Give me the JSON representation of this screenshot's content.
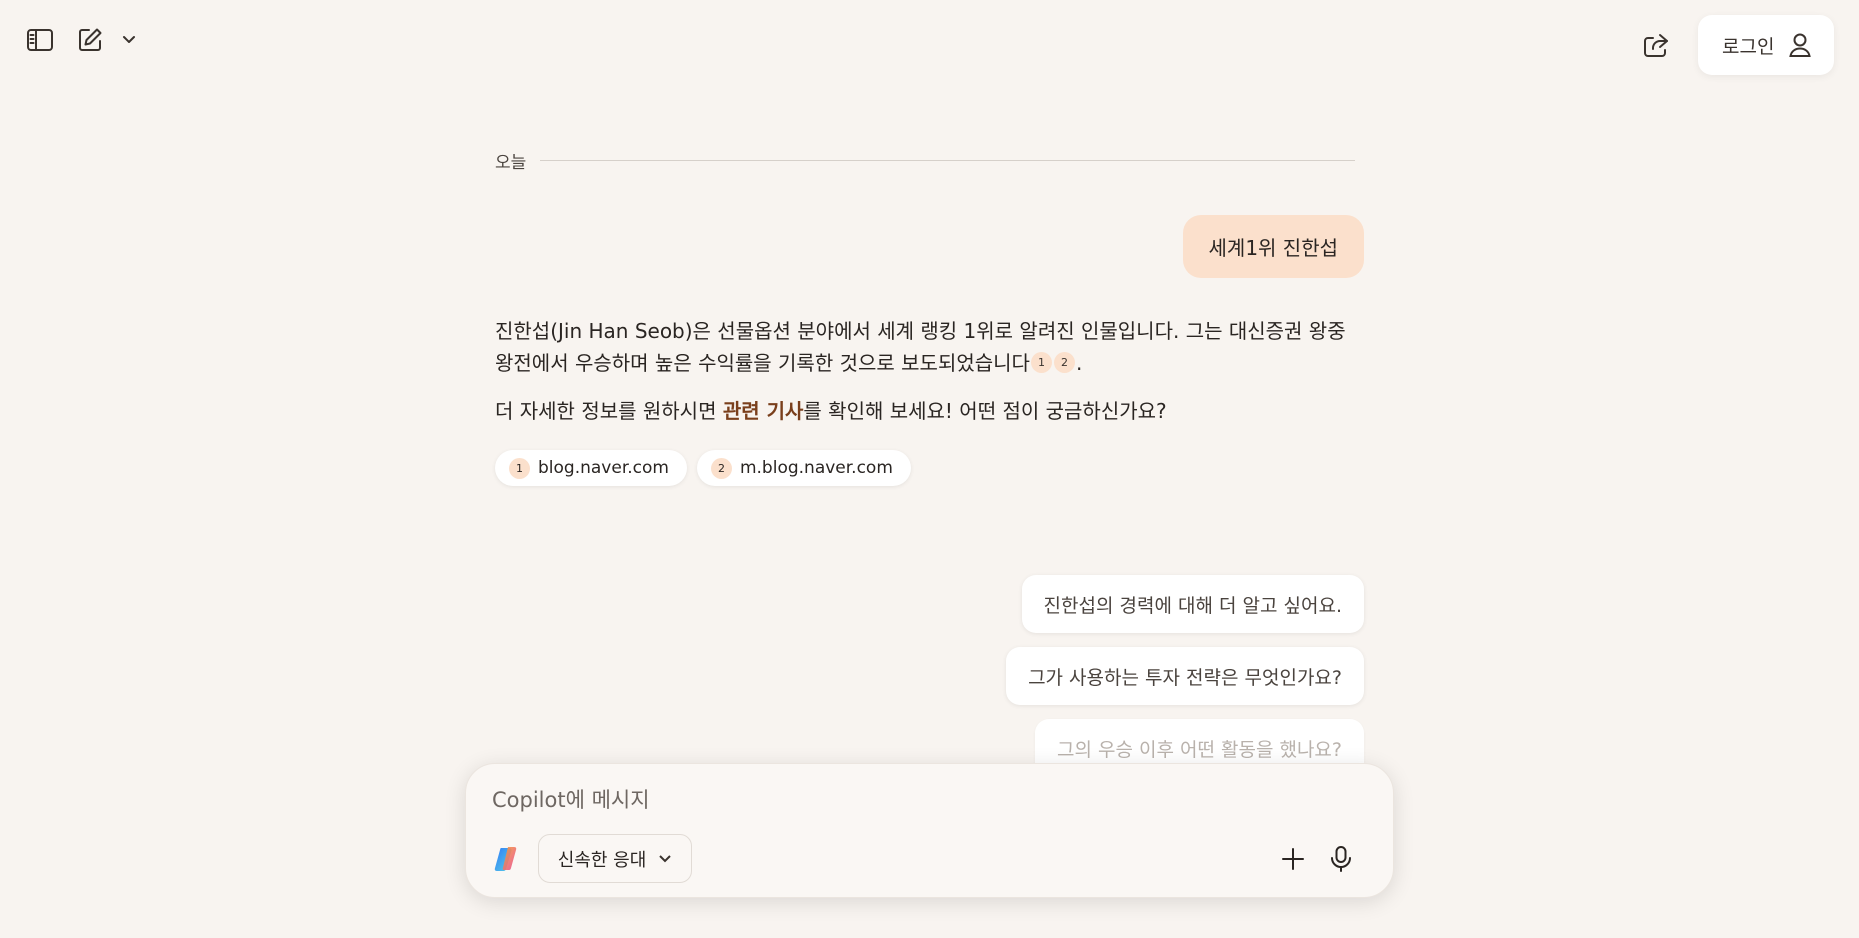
{
  "header": {
    "sidebar_icon": "sidebar-toggle-icon",
    "new_chat_icon": "compose-icon",
    "dropdown_icon": "chevron-down-icon",
    "share_icon": "share-icon",
    "login_label": "로그인",
    "user_icon": "user-icon"
  },
  "conversation": {
    "day_label": "오늘",
    "user_message": "세계1위 진한섭",
    "answer": {
      "p1_text": "진한섭(Jin Han Seob)은 선물옵션 분야에서 세계 랭킹 1위로 알려진 인물입니다. 그는 대신증권 왕중왕전에서 우승하며 높은 수익률을 기록한 것으로 보도되었습니다",
      "cite1": "1",
      "cite2": "2",
      "p1_end": ".",
      "p2_before": "더 자세한 정보를 원하시면 ",
      "p2_link": "관련 기사",
      "p2_after": "를 확인해 보세요! 어떤 점이 궁금하신가요?"
    },
    "sources": [
      {
        "num": "1",
        "label": "blog.naver.com"
      },
      {
        "num": "2",
        "label": "m.blog.naver.com"
      }
    ],
    "suggestions": [
      "진한섭의 경력에 대해 더 알고 싶어요.",
      "그가 사용하는 투자 전략은 무엇인가요?",
      "그의 우승 이후 어떤 활동을 했나요?"
    ]
  },
  "composer": {
    "placeholder": "Copilot에 메시지",
    "logo_icon": "copilot-logo-icon",
    "mode_label": "신속한 응대",
    "plus_icon": "plus-icon",
    "mic_icon": "microphone-icon"
  },
  "colors": {
    "background": "#f8f4f0",
    "user_bubble": "#fbe0cc",
    "link_accent": "#7a3f1c"
  }
}
